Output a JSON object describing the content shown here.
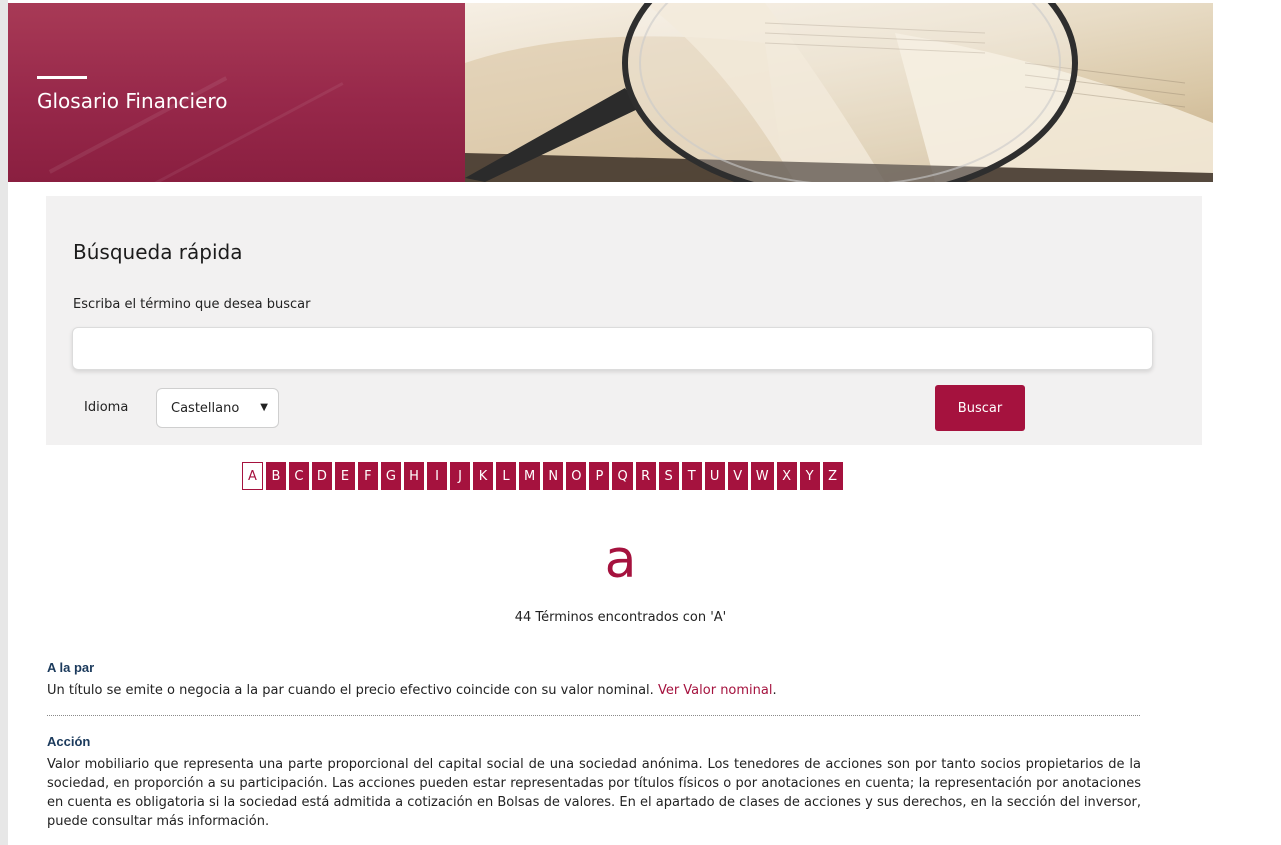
{
  "banner": {
    "title": "Glosario Financiero"
  },
  "search": {
    "title": "Búsqueda rápida",
    "label": "Escriba el término que desea buscar",
    "input_value": "",
    "language_label": "Idioma",
    "language_selected": "Castellano",
    "button_label": "Buscar"
  },
  "alphabet": {
    "letters": [
      "A",
      "B",
      "C",
      "D",
      "E",
      "F",
      "G",
      "H",
      "I",
      "J",
      "K",
      "L",
      "M",
      "N",
      "O",
      "P",
      "Q",
      "R",
      "S",
      "T",
      "U",
      "V",
      "W",
      "X",
      "Y",
      "Z"
    ],
    "active": "A"
  },
  "results": {
    "big_letter": "a",
    "count_text": "44 Términos encontrados con 'A'"
  },
  "entries": [
    {
      "term": "A la par",
      "definition": "Un título se emite o negocia a la par cuando el precio efectivo coincide con su valor nominal. ",
      "link_text": "Ver Valor nominal",
      "suffix": "."
    },
    {
      "term": "Acción",
      "definition": "Valor mobiliario que representa una parte proporcional del capital social de una sociedad anónima. Los tenedores de acciones son por tanto socios propietarios de la sociedad, en proporción a su participación. Las acciones pueden estar representadas por títulos físicos o por anotaciones en cuenta; la representación por anotaciones en cuenta es obligatoria si la sociedad está admitida a cotización en Bolsas de valores. En el apartado de clases de acciones y sus derechos, en la sección del inversor, puede consultar más información."
    }
  ],
  "colors": {
    "brand": "#a5123e",
    "term_title": "#1b3a5c",
    "panel_bg": "#f2f1f1"
  },
  "icons": {
    "select_arrow": "chevron-down-icon"
  }
}
